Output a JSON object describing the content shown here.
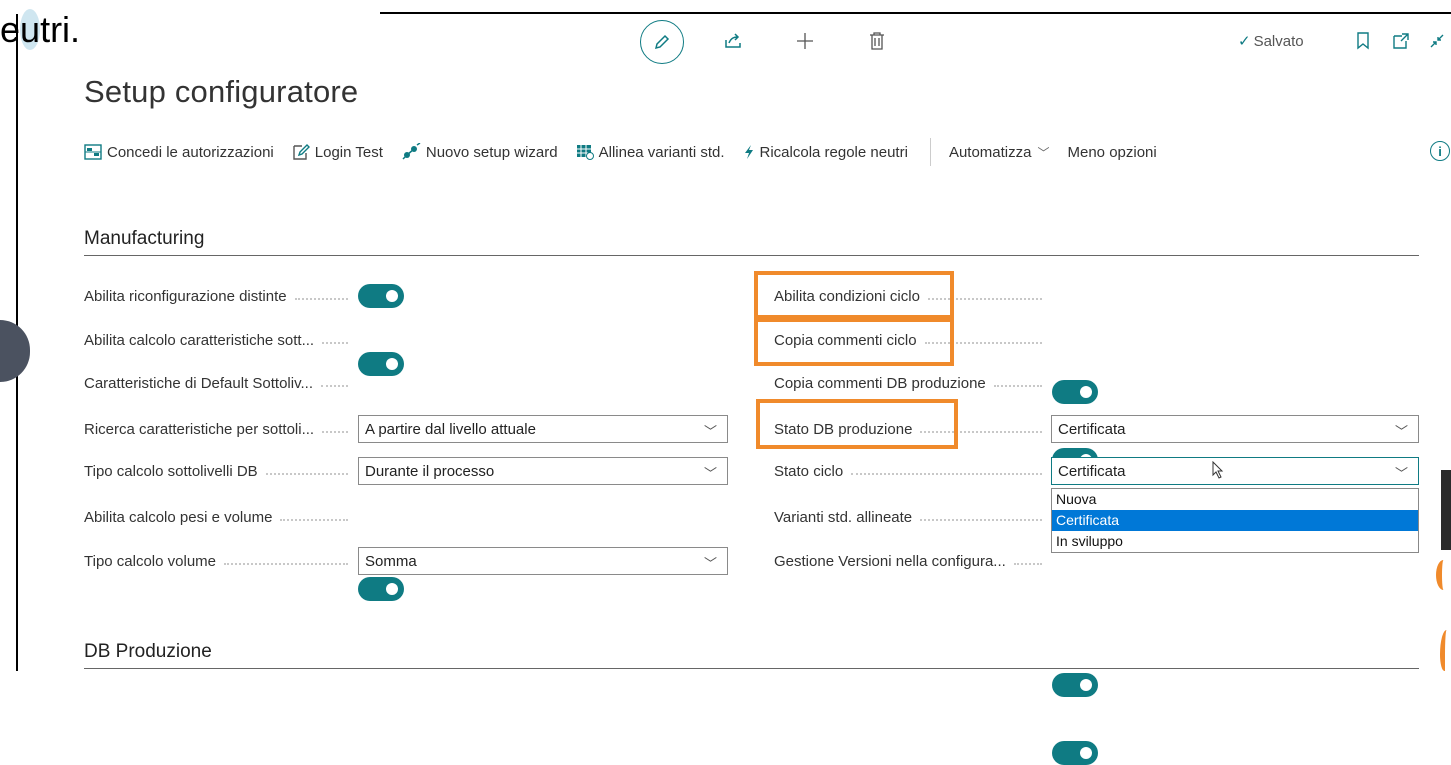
{
  "overlay": {
    "text_prefix": "e",
    "text_highlight": "u",
    "text_rest": "tri."
  },
  "header": {
    "saved_label": "Salvato"
  },
  "page": {
    "title": "Setup configuratore"
  },
  "toolbar": {
    "items": [
      {
        "label": "Concedi le autorizzazioni",
        "icon": "permissions-icon"
      },
      {
        "label": "Login Test",
        "icon": "login-edit-icon"
      },
      {
        "label": "Nuovo setup wizard",
        "icon": "wizard-icon"
      },
      {
        "label": "Allinea varianti std.",
        "icon": "align-variants-icon"
      },
      {
        "label": "Ricalcola regole neutri",
        "icon": "lightning-icon"
      }
    ],
    "automate_label": "Automatizza",
    "less_options_label": "Meno opzioni"
  },
  "manufacturing": {
    "title": "Manufacturing",
    "left_fields": [
      {
        "label": "Abilita riconfigurazione distinte",
        "type": "toggle",
        "value": "on"
      },
      {
        "label": "Abilita calcolo caratteristiche sott...",
        "type": "toggle",
        "value": "on"
      },
      {
        "label": "Caratteristiche di Default Sottoliv...",
        "type": "toggle",
        "value": "on"
      },
      {
        "label": "Ricerca caratteristiche per sottoli...",
        "type": "select",
        "value": "A partire dal livello attuale"
      },
      {
        "label": "Tipo calcolo sottolivelli DB",
        "type": "select",
        "value": "Durante il processo"
      },
      {
        "label": "Abilita calcolo pesi e volume",
        "type": "toggle",
        "value": "on"
      },
      {
        "label": "Tipo calcolo volume",
        "type": "select",
        "value": "Somma"
      }
    ],
    "right_fields": [
      {
        "label": "Abilita condizioni ciclo",
        "type": "toggle",
        "value": "on"
      },
      {
        "label": "Copia commenti ciclo",
        "type": "toggle",
        "value": "on"
      },
      {
        "label": "Copia commenti DB produzione",
        "type": "toggle",
        "value": "on"
      },
      {
        "label": "Stato DB produzione",
        "type": "select",
        "value": "Certificata"
      },
      {
        "label": "Stato ciclo",
        "type": "select",
        "value": "Certificata"
      },
      {
        "label": "Varianti std. allineate",
        "type": "toggle",
        "value": "on"
      },
      {
        "label": "Gestione Versioni nella configura...",
        "type": "toggle",
        "value": "on"
      }
    ],
    "dropdown_options": [
      "Nuova",
      "Certificata",
      "In sviluppo"
    ],
    "dropdown_selected": "Certificata"
  },
  "db_production": {
    "title": "DB Produzione"
  },
  "colors": {
    "accent": "#0f7b83",
    "highlight": "#f08a2b",
    "selected_option": "#0078d7"
  }
}
